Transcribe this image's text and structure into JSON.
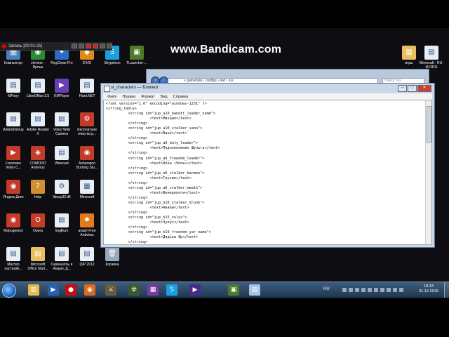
{
  "watermark": "www.Bandicam.com",
  "recorder": {
    "label": "Запись [00:01:25]"
  },
  "desktop_icons_left": [
    {
      "name": "computer",
      "label": "Компьютер",
      "color": "#4a7fc1",
      "glyph": "🖥"
    },
    {
      "name": "chrome",
      "label": "chrome - Ярлык",
      "color": "#2a8a3a",
      "glyph": "◉"
    },
    {
      "name": "regclean",
      "label": "RegClean Pro",
      "color": "#2a6cc6",
      "glyph": "✦"
    },
    {
      "name": "2gis",
      "label": "2ГИС",
      "color": "#e08a1a",
      "glyph": "◆"
    },
    {
      "name": "skype",
      "label": "Skypelcon",
      "color": "#1ba0e1",
      "glyph": "S"
    },
    {
      "name": "tlauncher",
      "label": "TLauncher-...",
      "color": "#4e7a2a",
      "glyph": "▣"
    },
    {
      "name": "mpony",
      "label": "MPony",
      "color": "#e8eef5",
      "glyph": "▤"
    },
    {
      "name": "libreoffice",
      "label": "LibreOffice 3.5",
      "color": "#e8eef5",
      "glyph": "▤"
    },
    {
      "name": "kmplayer",
      "label": "KMPlayer",
      "color": "#6a3fb3",
      "glyph": "▶"
    },
    {
      "name": "paintnet",
      "label": "Paint.NET",
      "color": "#e8eef5",
      "glyph": "▤"
    },
    {
      "name": "adobedebug",
      "label": "AdobeDebug",
      "color": "#e8eef5",
      "glyph": "▤"
    },
    {
      "name": "adobereader",
      "label": "Adobe Reader X",
      "color": "#e8eef5",
      "glyph": "▤"
    },
    {
      "name": "videowebcam",
      "label": "Video Web Camera",
      "color": "#e8eef5",
      "glyph": "▤"
    },
    {
      "name": "cleaner",
      "label": "Бесплатная очистка р...",
      "color": "#c43b2a",
      "glyph": "⚙"
    },
    {
      "name": "freemake",
      "label": "Freemake Video C...",
      "color": "#c43b2a",
      "glyph": "▶"
    },
    {
      "name": "comodo",
      "label": "COMODO Antivirus",
      "color": "#c43b2a",
      "glyph": "◈"
    },
    {
      "name": "wirecast",
      "label": "Wirecast",
      "color": "#e8eef5",
      "glyph": "▤"
    },
    {
      "name": "ashampoo",
      "label": "Ashampoo Burning Stu...",
      "color": "#c43b2a",
      "glyph": "◉"
    },
    {
      "name": "yandexdisk",
      "label": "Яндекс.Диск",
      "color": "#c43b2a",
      "glyph": "◉"
    },
    {
      "name": "help",
      "label": "Help",
      "color": "#d09030",
      "glyph": "?"
    },
    {
      "name": "libeay",
      "label": "libeay32.dll",
      "color": "#e8eef5",
      "glyph": "⚙"
    },
    {
      "name": "minecraft",
      "label": "Minecraft",
      "color": "#e8eef5",
      "glyph": "▦"
    },
    {
      "name": "mobogenie",
      "label": "Mobogenie3",
      "color": "#c43b2a",
      "glyph": "◉"
    },
    {
      "name": "opera",
      "label": "Opera",
      "color": "#c43b2a",
      "glyph": "O"
    },
    {
      "name": "imgburn",
      "label": "ImgBurn",
      "color": "#e8eef5",
      "glyph": "▤"
    },
    {
      "name": "avast",
      "label": "avast! Free Antivirus",
      "color": "#e07a1a",
      "glyph": "✸"
    },
    {
      "name": "master",
      "label": "Мастер настройк...",
      "color": "#e8eef5",
      "glyph": "▤"
    },
    {
      "name": "officestart",
      "label": "Microsoft Office Start...",
      "color": "#e8c060",
      "glyph": "▤"
    },
    {
      "name": "screenshots",
      "label": "Скриншоты в Яндекс.Д...",
      "color": "#e8eef5",
      "glyph": "▤"
    },
    {
      "name": "qip",
      "label": "QIP 2012",
      "color": "#e8eef5",
      "glyph": "▤"
    },
    {
      "name": "recycle",
      "label": "Корзина",
      "color": "#9aa8b8",
      "glyph": "🗑"
    }
  ],
  "desktop_icons_right": [
    {
      "name": "games",
      "label": "игры",
      "color": "#e8c060",
      "glyph": "▥"
    },
    {
      "name": "minecraft-ru",
      "label": "Minecraft - RU-M.ORG",
      "color": "#e8eef5",
      "glyph": "▤"
    }
  ],
  "explorer": {
    "address": "« gamedata › configs › text › rus",
    "search_placeholder": "Поиск: rus"
  },
  "notepad": {
    "title": "st_characters — Блокнот",
    "menu": [
      "Файл",
      "Правка",
      "Формат",
      "Вид",
      "Справка"
    ],
    "lines": [
      "<?xml version=\"1.0\" encoding=\"windows-1251\" ?>",
      "<string_table>",
      "          <string id=\"jup_a10_bandit_leader_name\">",
      "                    <text>Михаил</text>",
      "          </string>",
      "          <string id=\"jup_a10_stalker_vano\">",
      "                    <text>Вано</text>",
      "          </string>",
      "          <string id=\"jup_a6_duty_leader\">",
      "                    <text>Подполковник Шульга</text>",
      "          </string>",
      "          <string id=\"jup_a6_freedom_leader\">",
      "                    <text>Локи «Чпок»</text>",
      "          </string>",
      "          <string id=\"jup_a6_stalker_barmen\">",
      "                    <text>Грузин</text>",
      "          </string>",
      "          <string id=\"jup_a6_stalker_medik\">",
      "                    <text>Венерологи</text>",
      "          </string>",
      "          <string id=\"jup_b10_stalker_drunk\">",
      "                    <text>Авиаш</text>",
      "          </string>",
      "          <string id=\"jup_b15_zulus\">",
      "                    <text>Зулус</text>",
      "          </string>",
      "          <string id=\"jup_b19_freedom_yar_name\">",
      "                    <text>Дядька Яр</text>",
      "          </string>"
    ]
  },
  "taskbar": {
    "items": [
      {
        "name": "explorer-task",
        "glyph": "▥",
        "color": "#e8b84a"
      },
      {
        "name": "media-task",
        "glyph": "▶",
        "color": "#2a5fb0"
      },
      {
        "name": "record-task",
        "glyph": "●",
        "color": "#c21010"
      },
      {
        "name": "firefox-task",
        "glyph": "◉",
        "color": "#e06a1a"
      },
      {
        "name": "stalker-task",
        "glyph": "⚔",
        "color": "#6a5a3a"
      },
      {
        "name": "game-task",
        "glyph": "☢",
        "color": "#3a5a2a"
      },
      {
        "name": "winrar-task",
        "glyph": "▦",
        "color": "#7a3aa0"
      },
      {
        "name": "skype-task",
        "glyph": "S",
        "color": "#1ba0e1"
      },
      {
        "name": "kmp-task",
        "glyph": "▶",
        "color": "#4a2a8a"
      },
      {
        "name": "minecraft-task",
        "glyph": "▣",
        "color": "#4e7a2a"
      },
      {
        "name": "notepad-task",
        "glyph": "▤",
        "color": "#a8c4e0"
      }
    ],
    "lang": "RU",
    "time": "18:23",
    "date": "31.12.2016"
  }
}
